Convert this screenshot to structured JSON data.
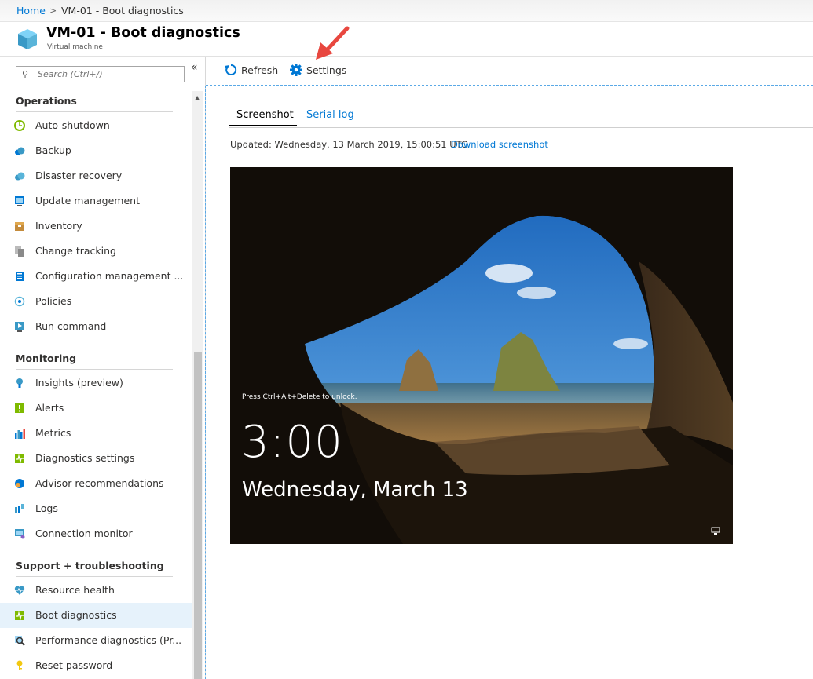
{
  "breadcrumb": {
    "home": "Home",
    "separator": ">",
    "current": "VM-01 - Boot diagnostics"
  },
  "header": {
    "title": "VM-01 - Boot diagnostics",
    "subtitle": "Virtual machine",
    "icon": "vm-cube-icon"
  },
  "search": {
    "placeholder": "Search (Ctrl+/)"
  },
  "sidebar": {
    "collapse_glyph": "«",
    "groups": [
      {
        "label": "Operations",
        "items": [
          {
            "label": "Auto-shutdown",
            "icon": "clock-icon"
          },
          {
            "label": "Backup",
            "icon": "cloud-backup-icon"
          },
          {
            "label": "Disaster recovery",
            "icon": "cloud-recovery-icon"
          },
          {
            "label": "Update management",
            "icon": "update-icon"
          },
          {
            "label": "Inventory",
            "icon": "box-icon"
          },
          {
            "label": "Change tracking",
            "icon": "document-icon"
          },
          {
            "label": "Configuration management ...",
            "icon": "config-icon"
          },
          {
            "label": "Policies",
            "icon": "policy-icon"
          },
          {
            "label": "Run command",
            "icon": "run-command-icon"
          }
        ]
      },
      {
        "label": "Monitoring",
        "items": [
          {
            "label": "Insights (preview)",
            "icon": "lightbulb-icon"
          },
          {
            "label": "Alerts",
            "icon": "alert-icon"
          },
          {
            "label": "Metrics",
            "icon": "metrics-icon"
          },
          {
            "label": "Diagnostics settings",
            "icon": "diagnostics-icon"
          },
          {
            "label": "Advisor recommendations",
            "icon": "advisor-icon"
          },
          {
            "label": "Logs",
            "icon": "logs-icon"
          },
          {
            "label": "Connection monitor",
            "icon": "connection-monitor-icon"
          }
        ]
      },
      {
        "label": "Support + troubleshooting",
        "items": [
          {
            "label": "Resource health",
            "icon": "heart-icon"
          },
          {
            "label": "Boot diagnostics",
            "icon": "boot-diagnostics-icon",
            "active": true
          },
          {
            "label": "Performance diagnostics (Pr...",
            "icon": "magnifier-icon"
          },
          {
            "label": "Reset password",
            "icon": "key-icon"
          }
        ]
      }
    ]
  },
  "toolbar": {
    "refresh": "Refresh",
    "settings": "Settings"
  },
  "tabs": {
    "screenshot": "Screenshot",
    "serial_log": "Serial log"
  },
  "status": {
    "updated": "Updated: Wednesday, 13 March 2019, 15:00:51 UTC",
    "download": "Download screenshot"
  },
  "lockscreen": {
    "unlock_hint": "Press Ctrl+Alt+Delete to unlock.",
    "time": "3:00",
    "date": "Wednesday, March 13"
  },
  "colors": {
    "accent": "#0078d4",
    "active_bg": "#e6f2fb",
    "arrow": "#e8473f"
  }
}
